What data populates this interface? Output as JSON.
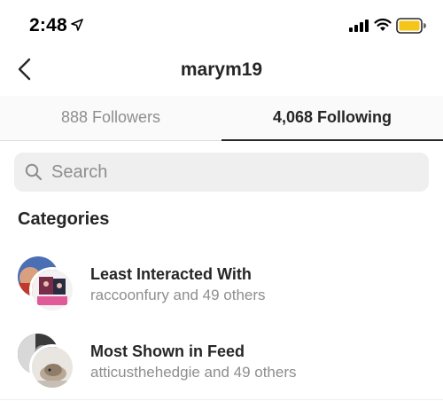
{
  "status_bar": {
    "time": "2:48",
    "location_icon": "location-arrow-icon",
    "signal_icon": "cellular-signal-icon",
    "wifi_icon": "wifi-icon",
    "battery_icon": "battery-icon",
    "battery_color": "#f5c518"
  },
  "header": {
    "back_icon": "chevron-left-icon",
    "title": "marym19"
  },
  "tabs": [
    {
      "label": "888 Followers",
      "selected": false
    },
    {
      "label": "4,068 Following",
      "selected": true
    }
  ],
  "search": {
    "placeholder": "Search",
    "value": "",
    "icon": "search-icon"
  },
  "categories": {
    "heading": "Categories",
    "items": [
      {
        "title": "Least Interacted With",
        "subtitle": "raccoonfury and 49 others"
      },
      {
        "title": "Most Shown in Feed",
        "subtitle": "atticusthehedgie and 49 others"
      }
    ]
  },
  "colors": {
    "primary_text": "#262626",
    "secondary_text": "#8e8e8e",
    "search_bg": "#efefef",
    "tab_bg": "#fafafa",
    "divider": "#dbdbdb"
  }
}
